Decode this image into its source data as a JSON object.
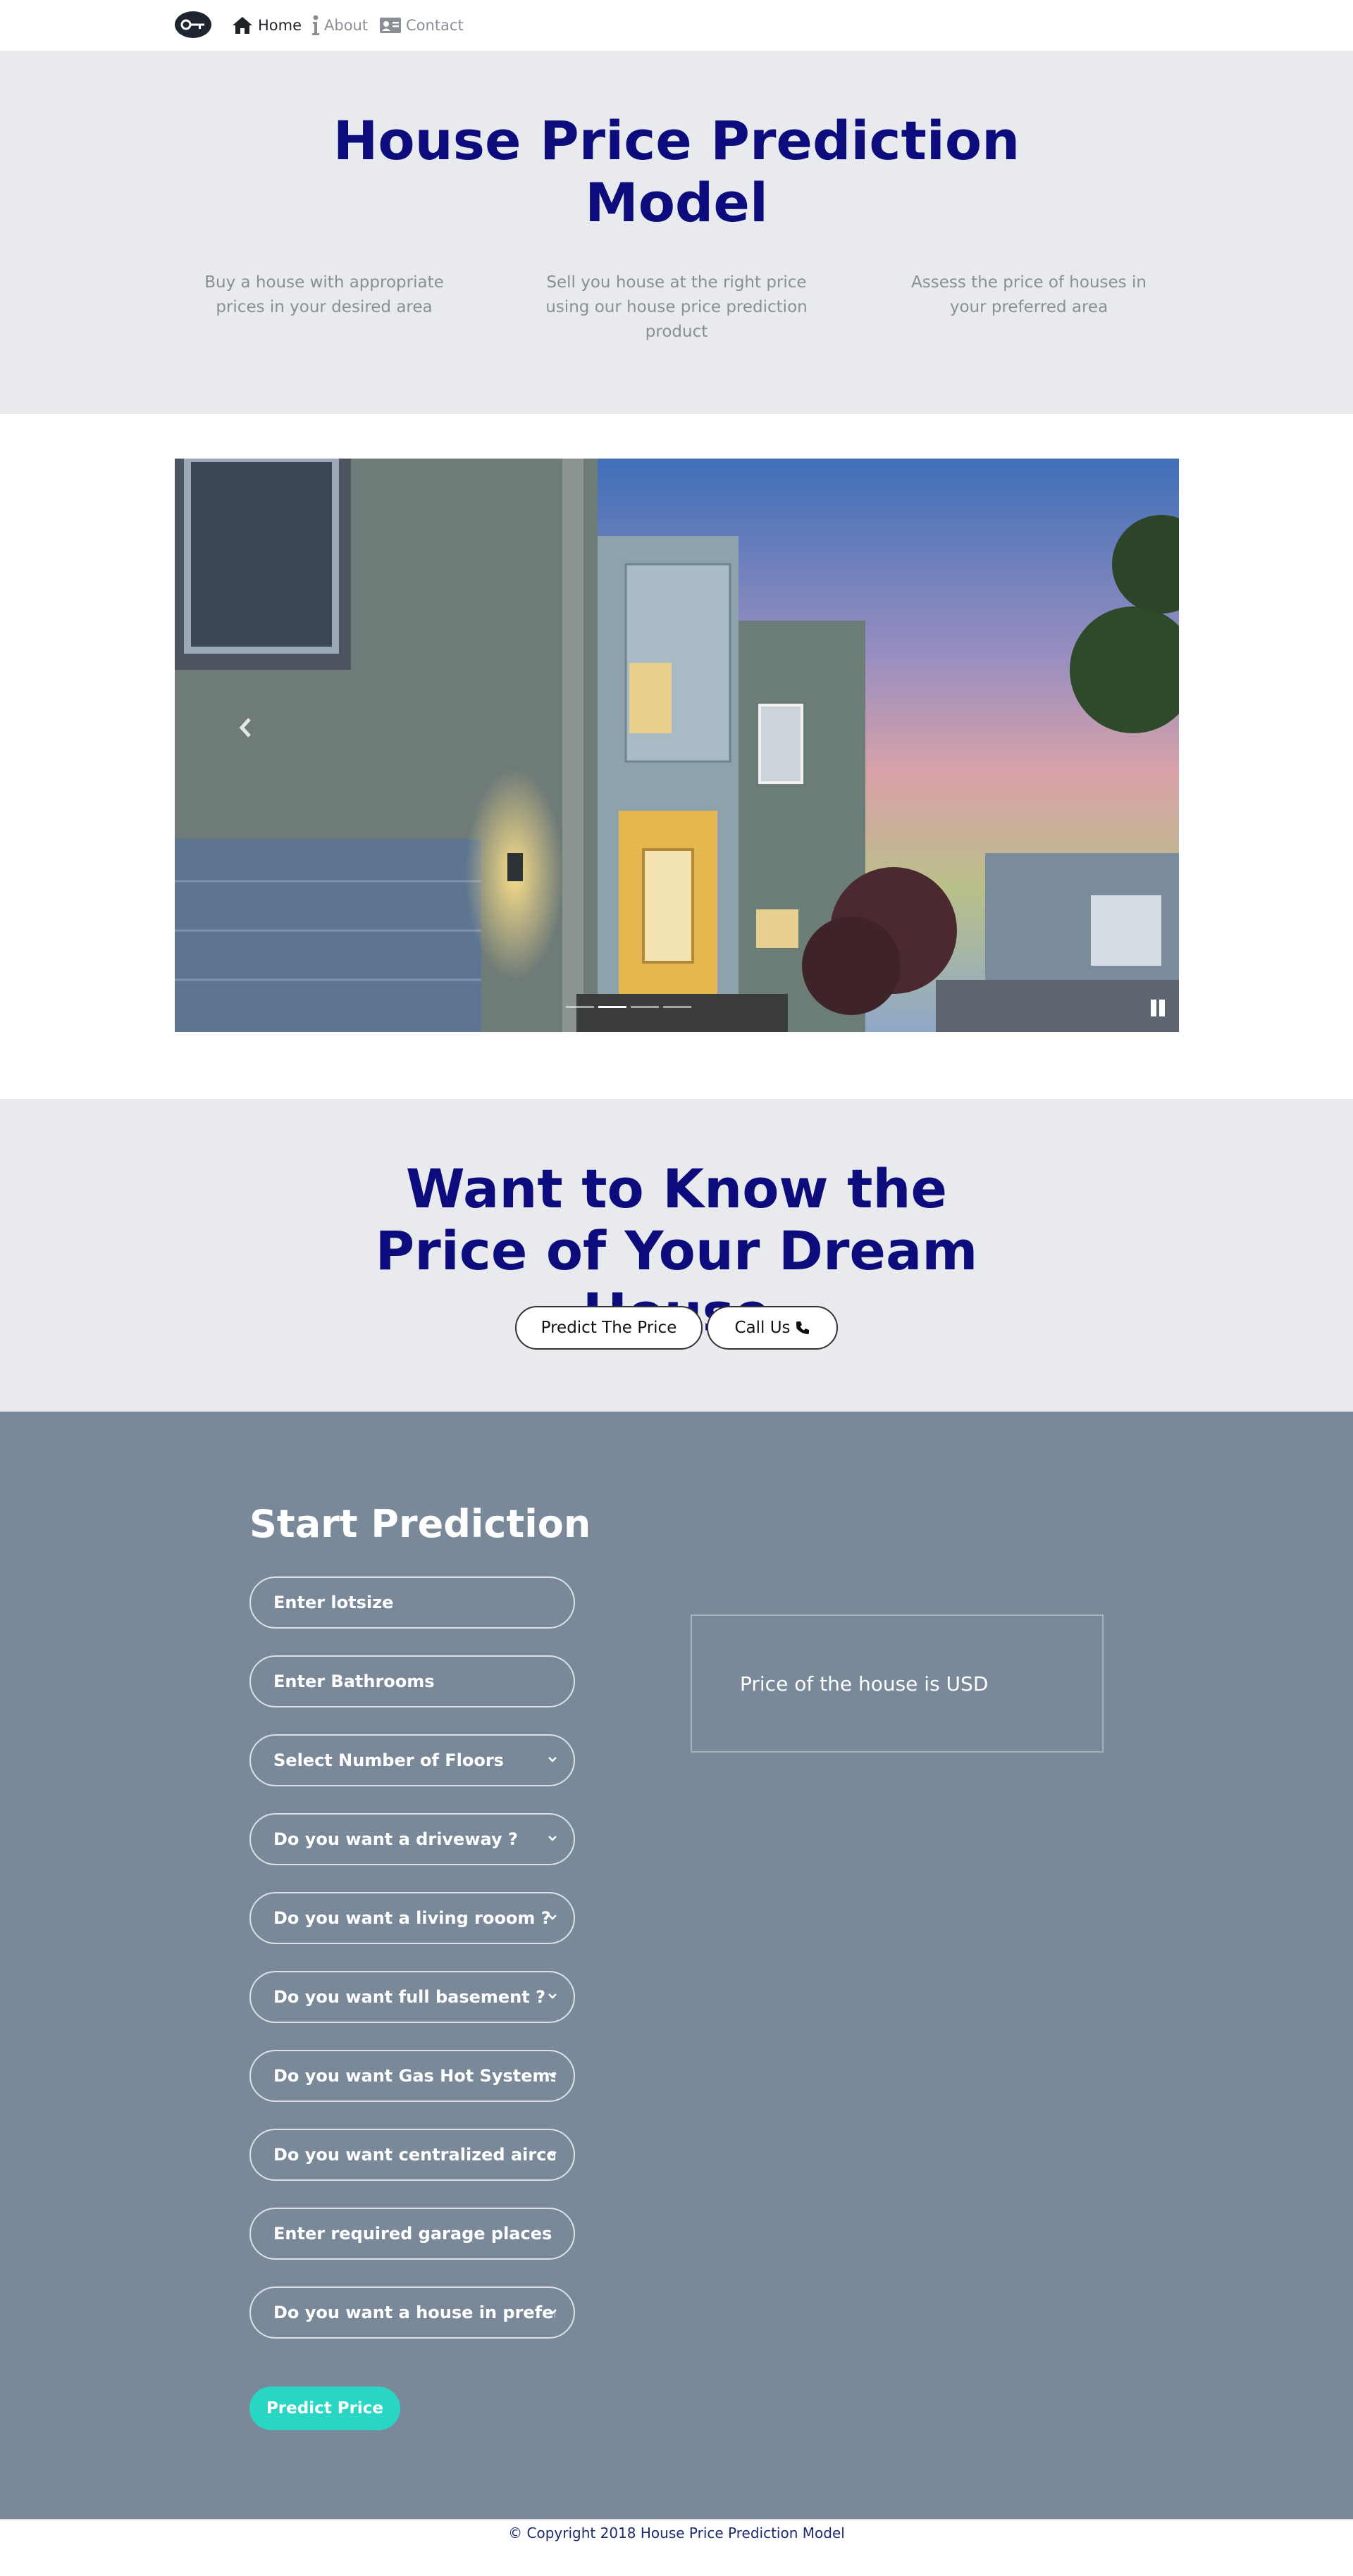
{
  "nav": {
    "logo_icon": "key-icon",
    "items": [
      {
        "label": "Home",
        "icon": "home-icon",
        "active": true
      },
      {
        "label": "About",
        "icon": "info-icon",
        "active": false
      },
      {
        "label": "Contact",
        "icon": "contact-card-icon",
        "active": false
      }
    ]
  },
  "hero": {
    "title": "House Price Prediction Model",
    "features": [
      "Buy a house with appropriate prices in your desired area",
      "Sell you house at the right price using our house price prediction product",
      "Assess the price of houses in your preferred area"
    ]
  },
  "carousel": {
    "image": "modern-house-at-dusk",
    "prev_icon": "chevron-left-icon",
    "pause_icon": "pause-icon",
    "indicator_count": 4,
    "active_indicator": 1
  },
  "cta": {
    "title": "Want to Know the Price of Your Dream House",
    "predict_button": "Predict The Price",
    "call_button": "Call Us",
    "call_icon": "phone-icon"
  },
  "prediction": {
    "title": "Start Prediction",
    "fields": [
      {
        "label": "Enter lotsize",
        "type": "input"
      },
      {
        "label": "Enter Bathrooms",
        "type": "input"
      },
      {
        "label": "Select Number of Floors",
        "type": "select"
      },
      {
        "label": "Do you want a driveway ?",
        "type": "select"
      },
      {
        "label": "Do you want a living rooom ?",
        "type": "select"
      },
      {
        "label": "Do you want full basement ?",
        "type": "select"
      },
      {
        "label": "Do you want Gas Hot Systems ?",
        "type": "select"
      },
      {
        "label": "Do you want centralized aircon",
        "type": "select"
      },
      {
        "label": "Enter required garage places",
        "type": "input"
      },
      {
        "label": "Do you want a house in preferre",
        "type": "select"
      }
    ],
    "result_text": "Price of the house is USD",
    "submit_button": "Predict Price"
  },
  "footer": {
    "copyright": "© Copyright 2018 House Price Prediction Model"
  },
  "colors": {
    "heading": "#0c0c7c",
    "hero_bg": "#e8eaed",
    "prediction_bg": "#798999",
    "accent": "#29d6c4"
  }
}
